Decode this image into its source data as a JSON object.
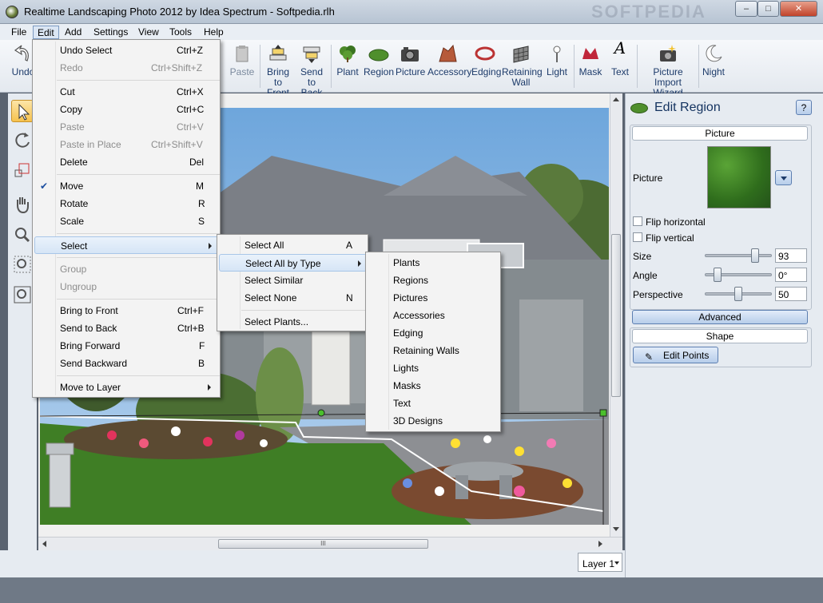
{
  "window": {
    "title": "Realtime Landscaping Photo 2012 by Idea Spectrum - Softpedia.rlh",
    "watermark": "SOFTPEDIA",
    "controls": [
      "–",
      "□",
      "✕"
    ]
  },
  "menubar": [
    "File",
    "Edit",
    "Add",
    "Settings",
    "View",
    "Tools",
    "Help"
  ],
  "toolbar": [
    {
      "label": "Undo",
      "icon": "undo-icon"
    },
    {
      "label": "Paste",
      "icon": "paste-icon",
      "disabled": true
    },
    {
      "label": "Bring to Front",
      "icon": "bring-to-front-icon"
    },
    {
      "label": "Send to Back",
      "icon": "send-to-back-icon"
    },
    {
      "label": "Plant",
      "icon": "plant-icon"
    },
    {
      "label": "Region",
      "icon": "region-icon"
    },
    {
      "label": "Picture",
      "icon": "picture-icon"
    },
    {
      "label": "Accessory",
      "icon": "accessory-icon"
    },
    {
      "label": "Edging",
      "icon": "edging-icon"
    },
    {
      "label": "Retaining Wall",
      "icon": "retaining-wall-icon"
    },
    {
      "label": "Light",
      "icon": "light-icon"
    },
    {
      "label": "Mask",
      "icon": "mask-icon"
    },
    {
      "label": "Text",
      "icon": "text-icon"
    },
    {
      "label": "Picture Import Wizard",
      "icon": "picture-import-wizard-icon"
    },
    {
      "label": "Night",
      "icon": "night-icon"
    }
  ],
  "edit_menu": [
    {
      "label": "Undo Select",
      "shortcut": "Ctrl+Z"
    },
    {
      "label": "Redo",
      "shortcut": "Ctrl+Shift+Z",
      "disabled": true
    },
    {
      "label": "Cut",
      "shortcut": "Ctrl+X"
    },
    {
      "label": "Copy",
      "shortcut": "Ctrl+C"
    },
    {
      "label": "Paste",
      "shortcut": "Ctrl+V",
      "disabled": true
    },
    {
      "label": "Paste in Place",
      "shortcut": "Ctrl+Shift+V",
      "disabled": true
    },
    {
      "label": "Delete",
      "shortcut": "Del"
    },
    {
      "label": "Move",
      "shortcut": "M",
      "checked": true
    },
    {
      "label": "Rotate",
      "shortcut": "R"
    },
    {
      "label": "Scale",
      "shortcut": "S"
    },
    {
      "label": "Select",
      "shortcut": "",
      "submenu": true
    },
    {
      "label": "Group",
      "shortcut": "",
      "disabled": true
    },
    {
      "label": "Ungroup",
      "shortcut": "",
      "disabled": true
    },
    {
      "label": "Bring to Front",
      "shortcut": "Ctrl+F"
    },
    {
      "label": "Send to Back",
      "shortcut": "Ctrl+B"
    },
    {
      "label": "Bring Forward",
      "shortcut": "F"
    },
    {
      "label": "Send Backward",
      "shortcut": "B"
    },
    {
      "label": "Move to Layer",
      "shortcut": "",
      "submenu": true
    }
  ],
  "select_menu": [
    {
      "label": "Select All",
      "shortcut": "A"
    },
    {
      "label": "Select All by Type",
      "shortcut": "",
      "submenu": true
    },
    {
      "label": "Select Similar",
      "shortcut": ""
    },
    {
      "label": "Select None",
      "shortcut": "N"
    },
    {
      "label": "Select Plants...",
      "shortcut": ""
    }
  ],
  "type_menu": [
    "Plants",
    "Regions",
    "Pictures",
    "Accessories",
    "Edging",
    "Retaining Walls",
    "Lights",
    "Masks",
    "Text",
    "3D Designs"
  ],
  "panel": {
    "title": "Edit Region",
    "help": "?",
    "picture_header": "Picture",
    "picture_label": "Picture",
    "flip_horizontal": "Flip horizontal",
    "flip_vertical": "Flip vertical",
    "size_label": "Size",
    "size_value": "93",
    "angle_label": "Angle",
    "angle_value": "0°",
    "perspective_label": "Perspective",
    "perspective_value": "50",
    "advanced": "Advanced",
    "shape": "Shape",
    "edit_points": "Edit Points"
  },
  "layer": "Layer 1",
  "scroll_grip": "III",
  "colors": {
    "accent": "#1d3b6a",
    "highlight": "#d6e5f6",
    "grass": "#3d7a25",
    "sky": "#7fb2e0"
  }
}
